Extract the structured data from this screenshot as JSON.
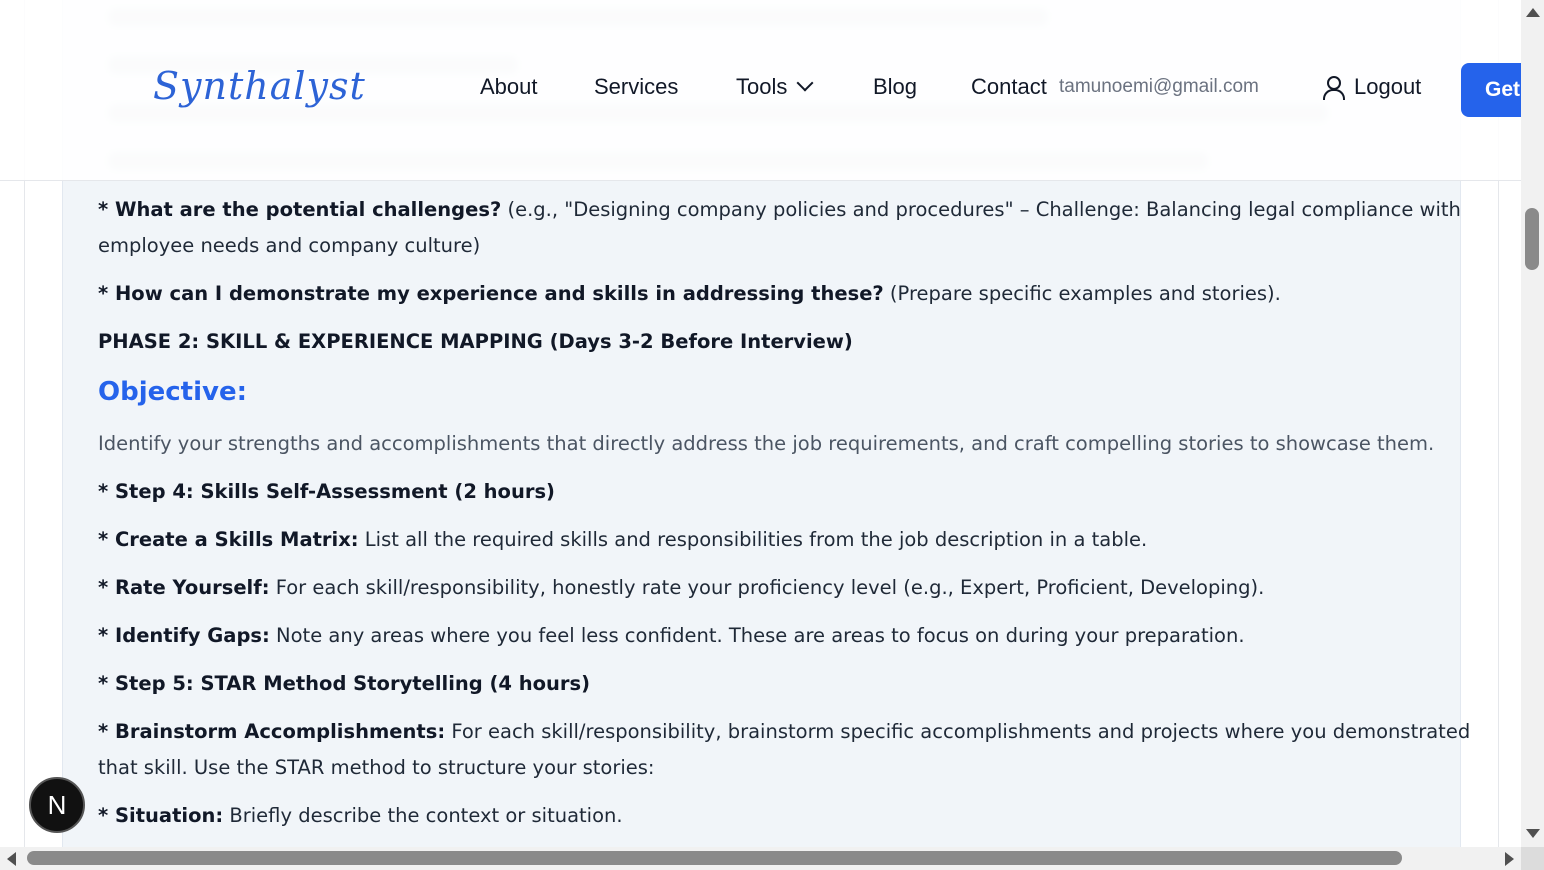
{
  "header": {
    "logo": "Synthalyst",
    "nav": {
      "about": "About",
      "services": "Services",
      "tools": "Tools",
      "blog": "Blog",
      "contact": "Contact"
    },
    "email": "tamunoemi@gmail.com",
    "logout": "Logout",
    "cta": "Get"
  },
  "content": {
    "q_challenges_bold": "* What are the potential challenges?",
    "q_challenges_rest": " (e.g., \"Designing company policies and procedures\" – Challenge: Balancing legal compliance with",
    "q_challenges_cont": "employee needs and company culture)",
    "q_demonstrate_bold": "* How can I demonstrate my experience and skills in addressing these?",
    "q_demonstrate_rest": " (Prepare specific examples and stories).",
    "phase2": "PHASE 2: SKILL & EXPERIENCE MAPPING (Days 3-2 Before Interview)",
    "objective_heading": "Objective:",
    "objective_text": "Identify your strengths and accomplishments that directly address the job requirements, and craft compelling stories to showcase them.",
    "step4": "* Step 4: Skills Self-Assessment (2 hours)",
    "skills_matrix_bold": "* Create a Skills Matrix:",
    "skills_matrix_rest": " List all the required skills and responsibilities from the job description in a table.",
    "rate_bold": "* Rate Yourself:",
    "rate_rest": " For each skill/responsibility, honestly rate your proficiency level (e.g., Expert, Proficient, Developing).",
    "gaps_bold": "* Identify Gaps:",
    "gaps_rest": " Note any areas where you feel less confident. These are areas to focus on during your preparation.",
    "step5": "* Step 5: STAR Method Storytelling (4 hours)",
    "brainstorm_bold": "* Brainstorm Accomplishments:",
    "brainstorm_rest": " For each skill/responsibility, brainstorm specific accomplishments and projects where you demonstrated",
    "brainstorm_cont": "that skill. Use the STAR method to structure your stories:",
    "situation_bold": "* Situation:",
    "situation_rest": " Briefly describe the context or situation."
  },
  "badge": "N"
}
